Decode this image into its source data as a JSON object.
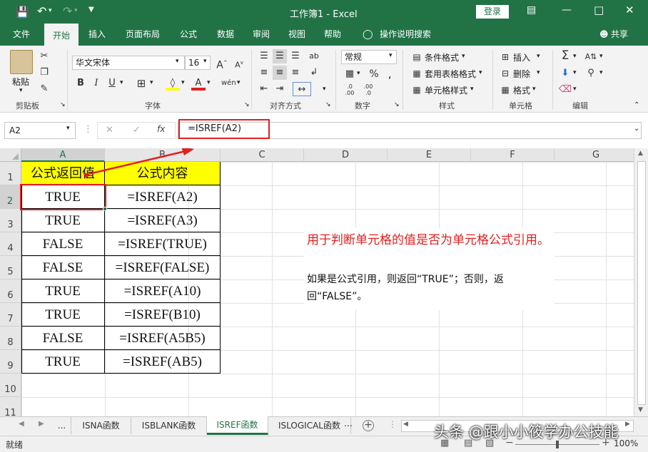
{
  "titlebar": {
    "title": "工作簿1  -  Excel",
    "login": "登录"
  },
  "tabs": [
    "文件",
    "开始",
    "插入",
    "页面布局",
    "公式",
    "数据",
    "审阅",
    "视图",
    "帮助",
    "操作说明搜索"
  ],
  "share": "共享",
  "ribbon": {
    "paste": "粘贴",
    "font_name": "华文宋体",
    "font_size": "16",
    "number_format": "常规",
    "cond_format": "条件格式",
    "table_format": "套用表格格式",
    "cell_style": "单元格样式",
    "insert": "插入",
    "delete": "删除",
    "format": "格式",
    "groups": {
      "clipboard": "剪贴板",
      "font": "字体",
      "align": "对齐方式",
      "number": "数字",
      "styles": "样式",
      "cells": "单元格",
      "edit": "编辑"
    }
  },
  "formula_bar": {
    "name_box": "A2",
    "fx": "fx",
    "formula": "=ISREF(A2)"
  },
  "columns": [
    "A",
    "B",
    "C",
    "D",
    "E",
    "F",
    "G"
  ],
  "rows": [
    "1",
    "2",
    "3",
    "4",
    "5",
    "6",
    "7",
    "8",
    "9",
    "10",
    "11"
  ],
  "table": {
    "header": [
      "公式返回值",
      "公式内容"
    ],
    "rows": [
      [
        "TRUE",
        "=ISREF(A2)"
      ],
      [
        "TRUE",
        "=ISREF(A3)"
      ],
      [
        "FALSE",
        "=ISREF(TRUE)"
      ],
      [
        "FALSE",
        "=ISREF(FALSE)"
      ],
      [
        "TRUE",
        "=ISREF(A10)"
      ],
      [
        "TRUE",
        "=ISREF(B10)"
      ],
      [
        "FALSE",
        "=ISREF(A5B5)"
      ],
      [
        "TRUE",
        "=ISREF(AB5)"
      ]
    ]
  },
  "note": {
    "red": "用于判断单元格的值是否为单元格公式引用。",
    "black": "如果是公式引用，则返回“TRUE”；否则，返回“FALSE”。"
  },
  "sheet_tabs": [
    "...",
    "ISNA函数",
    "ISBLANK函数",
    "ISREF函数",
    "ISLOGICAL函数"
  ],
  "status": {
    "ready": "就绪",
    "zoom": "100%"
  },
  "watermark": "头条 @跟小小筱学办公技能",
  "colors": {
    "accent": "#217346",
    "header_fill": "#ffff00",
    "annotation": "#e02020"
  }
}
